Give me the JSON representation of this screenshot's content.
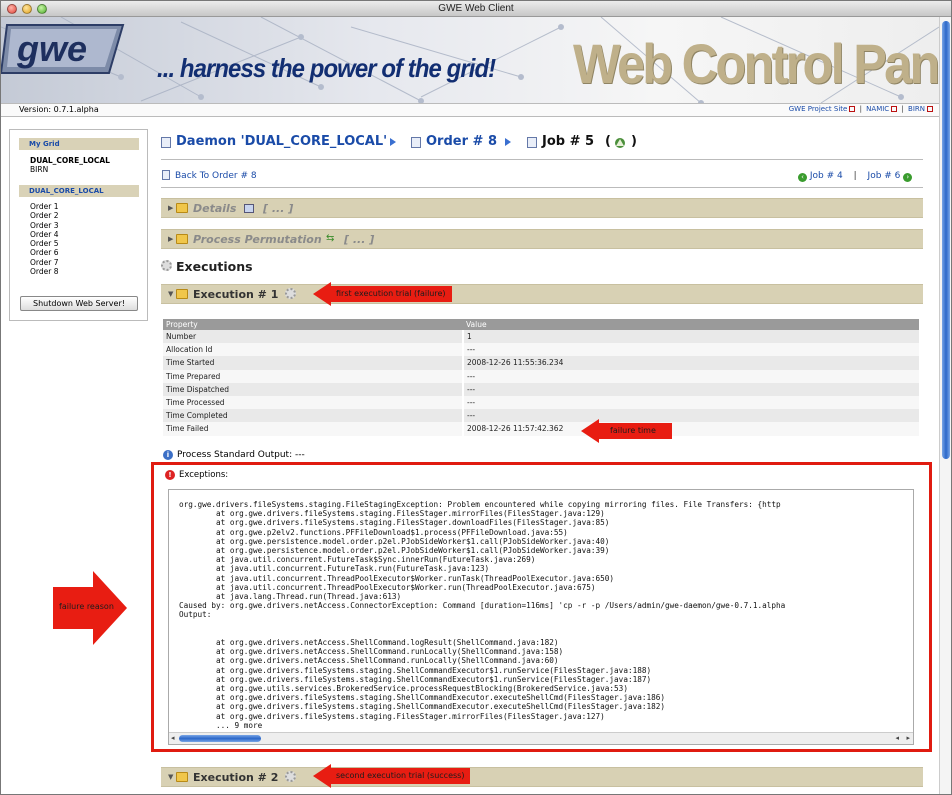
{
  "window": {
    "title": "GWE Web Client"
  },
  "banner": {
    "logo_text": "gwe",
    "tagline": "... harness the power of the grid!",
    "title": "Web Control Panel"
  },
  "infobar": {
    "version": "Version: 0.7.1.alpha",
    "links": [
      "GWE Project Site",
      "NAMIC",
      "BIRN"
    ]
  },
  "sidebar": {
    "my_grid": "My Grid",
    "grids": [
      "DUAL_CORE_LOCAL",
      "BIRN"
    ],
    "active_grid": "DUAL_CORE_LOCAL",
    "orders": [
      "Order 1",
      "Order 2",
      "Order 3",
      "Order 4",
      "Order 5",
      "Order 6",
      "Order 7",
      "Order 8"
    ],
    "shutdown": "Shutdown Web Server!"
  },
  "breadcrumb": {
    "daemon": "Daemon 'DUAL_CORE_LOCAL'",
    "order": "Order # 8",
    "job": "Job # 5",
    "job_status_open": "(",
    "job_status_close": ")"
  },
  "nav": {
    "back": "Back To Order # 8",
    "prev": "Job # 4",
    "sep": "|",
    "next": "Job # 6"
  },
  "sections": {
    "details": "Details",
    "details_ellipsis": "[ ... ]",
    "process_perm": "Process Permutation",
    "process_perm_ellipsis": "[ ... ]",
    "executions_title": "Executions",
    "execution1": "Execution # 1",
    "execution2": "Execution # 2"
  },
  "table": {
    "headers": [
      "Property",
      "Value"
    ],
    "rows": [
      [
        "Number",
        "1"
      ],
      [
        "Allocation Id",
        "---"
      ],
      [
        "Time Started",
        "2008-12-26 11:55:36.234"
      ],
      [
        "Time Prepared",
        "---"
      ],
      [
        "Time Dispatched",
        "---"
      ],
      [
        "Time Processed",
        "---"
      ],
      [
        "Time Completed",
        "---"
      ],
      [
        "Time Failed",
        "2008-12-26 11:57:42.362"
      ]
    ]
  },
  "process_stdout": "Process Standard Output: ---",
  "exceptions": {
    "label": "Exceptions:",
    "trace": "org.gwe.drivers.fileSystems.staging.FileStagingException: Problem encountered while copying mirroring files. File Transfers: {http\n        at org.gwe.drivers.fileSystems.staging.FilesStager.mirrorFiles(FilesStager.java:129)\n        at org.gwe.drivers.fileSystems.staging.FilesStager.downloadFiles(FilesStager.java:85)\n        at org.gwe.p2elv2.functions.PFFileDownload$1.process(PFFileDownload.java:55)\n        at org.gwe.persistence.model.order.p2el.PJobSideWorker$1.call(PJobSideWorker.java:40)\n        at org.gwe.persistence.model.order.p2el.PJobSideWorker$1.call(PJobSideWorker.java:39)\n        at java.util.concurrent.FutureTask$Sync.innerRun(FutureTask.java:269)\n        at java.util.concurrent.FutureTask.run(FutureTask.java:123)\n        at java.util.concurrent.ThreadPoolExecutor$Worker.runTask(ThreadPoolExecutor.java:650)\n        at java.util.concurrent.ThreadPoolExecutor$Worker.run(ThreadPoolExecutor.java:675)\n        at java.lang.Thread.run(Thread.java:613)\nCaused by: org.gwe.drivers.netAccess.ConnectorException: Command [duration=116ms] 'cp -r -p /Users/admin/gwe-daemon/gwe-0.7.1.alpha\nOutput:\n\n\n        at org.gwe.drivers.netAccess.ShellCommand.logResult(ShellCommand.java:182)\n        at org.gwe.drivers.netAccess.ShellCommand.runLocally(ShellCommand.java:158)\n        at org.gwe.drivers.netAccess.ShellCommand.runLocally(ShellCommand.java:60)\n        at org.gwe.drivers.fileSystems.staging.ShellCommandExecutor$1.runService(FilesStager.java:188)\n        at org.gwe.drivers.fileSystems.staging.ShellCommandExecutor$1.runService(FilesStager.java:187)\n        at org.gwe.utils.services.BrokeredService.processRequestBlocking(BrokeredService.java:53)\n        at org.gwe.drivers.fileSystems.staging.ShellCommandExecutor.executeShellCmd(FilesStager.java:186)\n        at org.gwe.drivers.fileSystems.staging.ShellCommandExecutor.executeShellCmd(FilesStager.java:182)\n        at org.gwe.drivers.fileSystems.staging.FilesStager.mirrorFiles(FilesStager.java:127)\n        ... 9 more"
  },
  "annotations": {
    "first_trial": "first execution trial (failure)",
    "failure_time": "failure time",
    "failure_reason": "failure reason",
    "second_trial": "second execution trial (success)"
  },
  "colors": {
    "link_blue": "#1a4ba8",
    "section_bar": "#d8d1b4",
    "annotation_red": "#e81d12"
  },
  "icons": [
    "document-icon",
    "chevron-right-icon",
    "warning-icon",
    "folder-icon",
    "gear-icon",
    "info-icon",
    "error-icon",
    "next-icon",
    "prev-icon",
    "external-link-icon"
  ]
}
